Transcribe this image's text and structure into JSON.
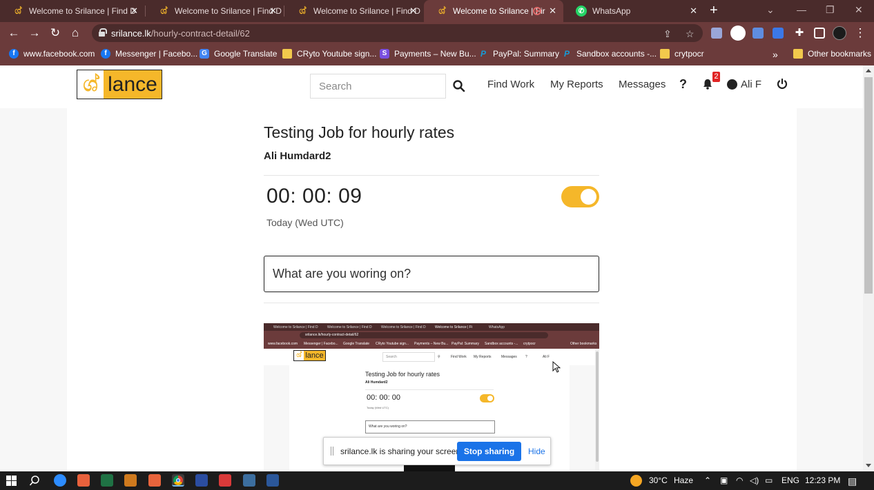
{
  "browser": {
    "tabs": [
      {
        "title": "Welcome to Srilance | Find D",
        "active": false
      },
      {
        "title": "Welcome to Srilance | Find D",
        "active": false
      },
      {
        "title": "Welcome to Srilance | Find D",
        "active": false
      },
      {
        "title": "Welcome to Srilance | Fir",
        "active": true
      },
      {
        "title": "WhatsApp",
        "active": false
      }
    ],
    "url_host": "srilance.lk",
    "url_path": "/hourly-contract-detail/62",
    "bookmarks": [
      "www.facebook.com",
      "Messenger | Facebo...",
      "Google Translate",
      "CRyto Youtube sign...",
      "Payments – New Bu...",
      "PayPal: Summary",
      "Sandbox accounts -...",
      "crytpocr"
    ],
    "other_bookmarks": "Other bookmarks",
    "overflow": "»"
  },
  "site": {
    "logo_mark": "ශ්",
    "logo_word": "lance",
    "search_placeholder": "Search",
    "nav": [
      "Find Work",
      "My Reports",
      "Messages"
    ],
    "help": "?",
    "notification_count": "2",
    "user_name": "Ali F"
  },
  "contract": {
    "title": "Testing Job for hourly rates",
    "client": "Ali Humdard2",
    "timer": "00: 00: 09",
    "timer_running": true,
    "period": "Today (Wed UTC)",
    "work_placeholder": "What are you woring on?"
  },
  "preview": {
    "tabs": [
      "Welcome to Srilance | Find D",
      "Welcome to Srilance | Find D",
      "Welcome to Srilance | Find D",
      "Welcome to Srilance | Fi",
      "WhatsApp"
    ],
    "url": "srilance.lk/hourly-contract-detail/62",
    "bookmarks": [
      "www.facebook.com",
      "Messenger | Facebo...",
      "Google Translate",
      "CRyto Youtube sign...",
      "Payments – New Bu...",
      "PayPal: Summary",
      "Sandbox accounts -...",
      "crytpocr",
      "Other bookmarks"
    ],
    "logo_word": "lance",
    "search": "Search",
    "nav": [
      "Find Work",
      "My Reports",
      "Messages",
      "?",
      "Ali F"
    ],
    "title": "Testing Job for hourly rates",
    "client": "Ali Humdard2",
    "timer": "00: 00: 00",
    "period": "Today (Wed UTC)",
    "input": "What are you woring on?"
  },
  "share": {
    "message": "srilance.lk is sharing your screen.",
    "stop_label": "Stop sharing",
    "hide_label": "Hide"
  },
  "taskbar": {
    "temperature": "30°C",
    "weather": "Haze",
    "language": "ENG",
    "time": "12:23 PM"
  },
  "colors": {
    "accent": "#f5b72a",
    "chrome_dark": "#4a2b2b",
    "chrome": "#6b3b3b",
    "link_blue": "#1a73e8"
  }
}
